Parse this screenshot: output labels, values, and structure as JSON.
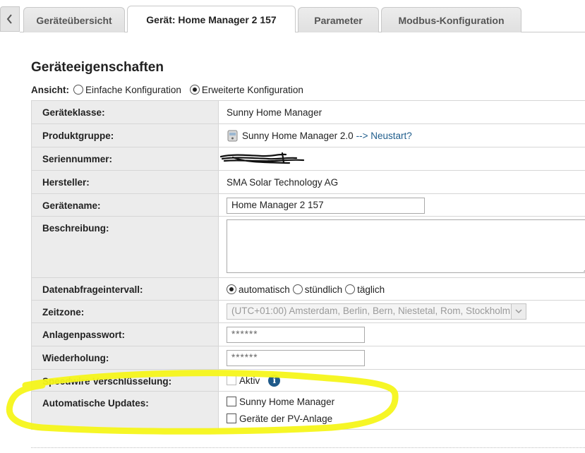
{
  "tabs": [
    {
      "label": "Geräteübersicht",
      "active": false
    },
    {
      "label": "Gerät: Home Manager 2 157",
      "active": true
    },
    {
      "label": "Parameter",
      "active": false
    },
    {
      "label": "Modbus-Konfiguration",
      "active": false
    }
  ],
  "page": {
    "title": "Geräteeigenschaften",
    "view_label": "Ansicht:",
    "view_options": [
      "Einfache Konfiguration",
      "Erweiterte Konfiguration"
    ],
    "view_selected": "Erweiterte Konfiguration"
  },
  "properties": {
    "device_class": {
      "label": "Geräteklasse:",
      "value": "Sunny Home Manager"
    },
    "product_group": {
      "label": "Produktgruppe:",
      "value": "Sunny Home Manager 2.0",
      "restart_link": "--> Neustart?"
    },
    "serial": {
      "label": "Seriennummer:"
    },
    "manufacturer": {
      "label": "Hersteller:",
      "value": "SMA Solar Technology AG"
    },
    "device_name": {
      "label": "Gerätename:",
      "value": "Home Manager 2 157"
    },
    "description": {
      "label": "Beschreibung:",
      "value": ""
    },
    "query_interval": {
      "label": "Datenabfrageintervall:",
      "options": [
        "automatisch",
        "stündlich",
        "täglich"
      ],
      "selected": "automatisch"
    },
    "timezone": {
      "label": "Zeitzone:",
      "value": "(UTC+01:00) Amsterdam, Berlin, Bern, Niestetal, Rom, Stockholm"
    },
    "system_password": {
      "label": "Anlagenpasswort:",
      "value": "******"
    },
    "repeat_password": {
      "label": "Wiederholung:",
      "value": "******"
    },
    "speedwire": {
      "label": "Speedwire Verschlüsselung:",
      "option": "Aktiv",
      "checked": false
    },
    "auto_updates": {
      "label": "Automatische Updates:",
      "options": [
        {
          "label": "Sunny Home Manager",
          "checked": false
        },
        {
          "label": "Geräte der PV-Anlage",
          "checked": false
        }
      ]
    }
  },
  "colors": {
    "label_bg": "#ececec",
    "link": "#1f5d8c",
    "info_icon": "#1f5a8a",
    "highlight": "#f5f51a"
  },
  "icons": {
    "back": "chevron-left-icon",
    "product": "home-manager-device-icon",
    "info": "info-icon"
  }
}
